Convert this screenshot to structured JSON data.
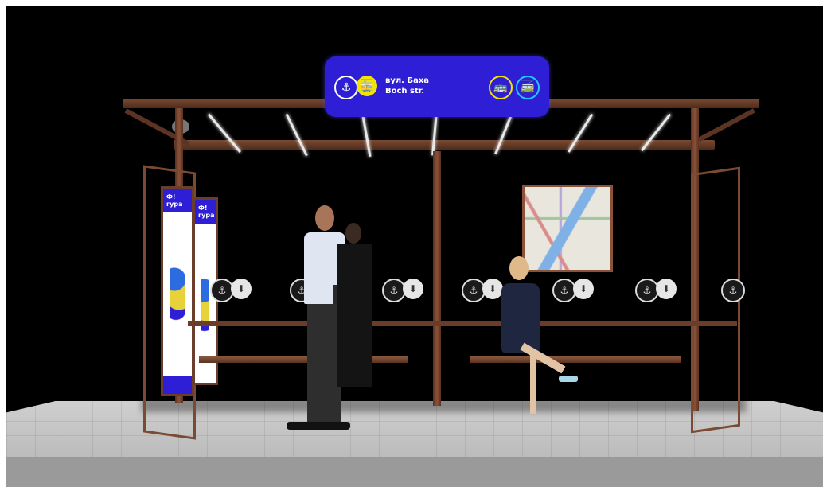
{
  "scene": {
    "description_type": "bus shelter rendering",
    "colors": {
      "background": "#000000",
      "sign": "#2e1fd6",
      "tram_icon": "#f2e400",
      "trolley_icon": "#27c7ff",
      "frame": "#7a4a32"
    }
  },
  "sign": {
    "line1": "вул. Баха",
    "line2": "Boch str.",
    "icons": [
      "anchor-icon",
      "tram-icon",
      "bus-icon",
      "trolleybus-icon"
    ]
  },
  "ad": {
    "brand": "Ф!гура"
  },
  "stop_icon_groups": 7
}
